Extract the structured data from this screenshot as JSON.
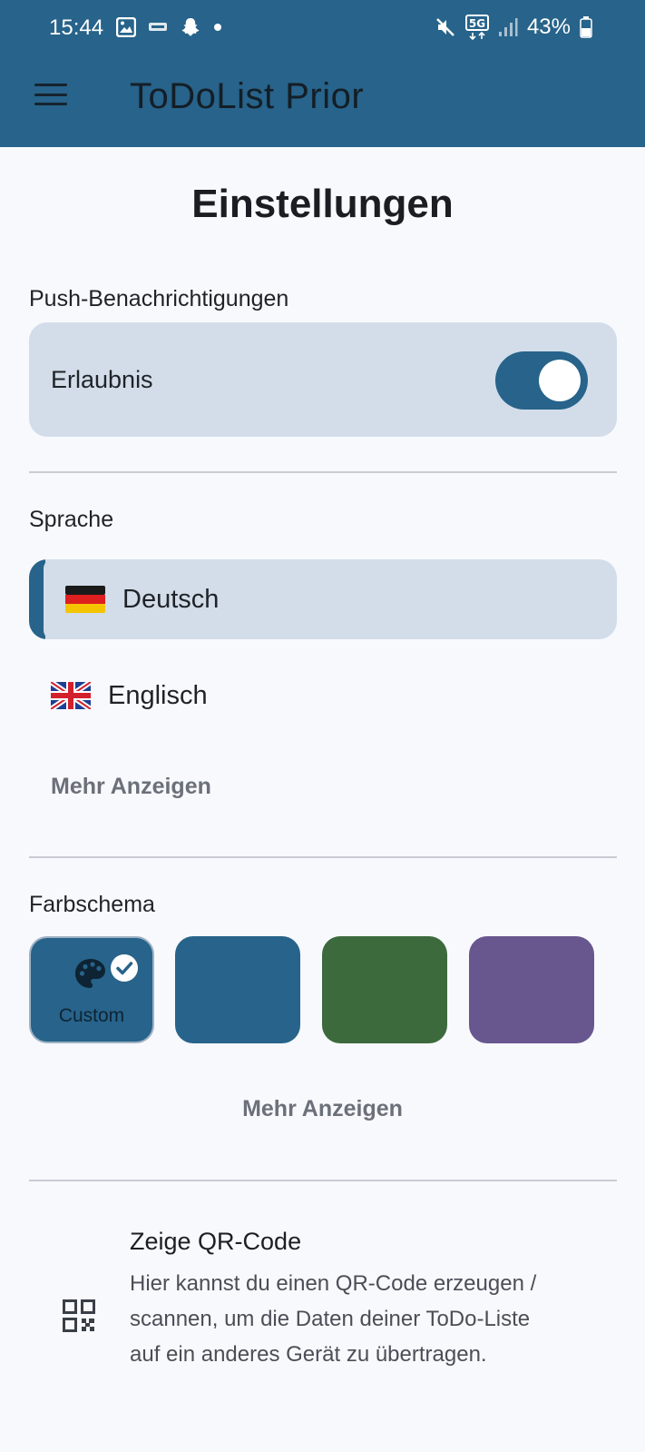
{
  "status_bar": {
    "time": "15:44",
    "battery": "43%",
    "network": "5G",
    "left_icons": [
      "image-icon",
      "notification-icon",
      "snapchat-icon",
      "dot-icon"
    ],
    "right_icons": [
      "mute-icon",
      "5g-icon",
      "signal-icon",
      "battery-icon"
    ]
  },
  "app_bar": {
    "title": "ToDoList Prior",
    "menu_icon": "menu-icon",
    "color": "#27638a"
  },
  "page": {
    "title": "Einstellungen"
  },
  "notifications": {
    "section_label": "Push-Benachrichtigungen",
    "permission_label": "Erlaubnis",
    "permission_enabled": true
  },
  "language": {
    "section_label": "Sprache",
    "options": [
      {
        "label": "Deutsch",
        "flag": "germany-flag",
        "selected": true
      },
      {
        "label": "Englisch",
        "flag": "uk-flag",
        "selected": false
      }
    ],
    "more_label": "Mehr Anzeigen"
  },
  "color_scheme": {
    "section_label": "Farbschema",
    "swatches": [
      {
        "label": "Custom",
        "color": "#27638a",
        "selected": true,
        "icon": "palette-icon"
      },
      {
        "label": "",
        "color": "#27638a",
        "selected": false
      },
      {
        "label": "",
        "color": "#3c6a3d",
        "selected": false
      },
      {
        "label": "",
        "color": "#68568f",
        "selected": false
      }
    ],
    "more_label": "Mehr Anzeigen"
  },
  "qr_code": {
    "title": "Zeige QR-Code",
    "description": "Hier kannst du einen QR-Code erzeugen / scannen, um die Daten deiner ToDo-Liste auf ein anderes Gerät zu übertragen.",
    "icon": "qr-code-icon"
  }
}
